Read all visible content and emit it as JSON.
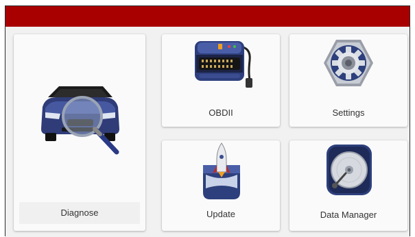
{
  "header": {
    "color": "#a80000"
  },
  "tiles": {
    "diagnose": {
      "label": "Diagnose",
      "icon": "car-magnifier-icon"
    },
    "obdii": {
      "label": "OBDII",
      "icon": "obd-connector-icon"
    },
    "settings": {
      "label": "Settings",
      "icon": "gear-icon"
    },
    "update": {
      "label": "Update",
      "icon": "rocket-icon"
    },
    "data_manager": {
      "label": "Data Manager",
      "icon": "hard-disk-icon"
    }
  }
}
